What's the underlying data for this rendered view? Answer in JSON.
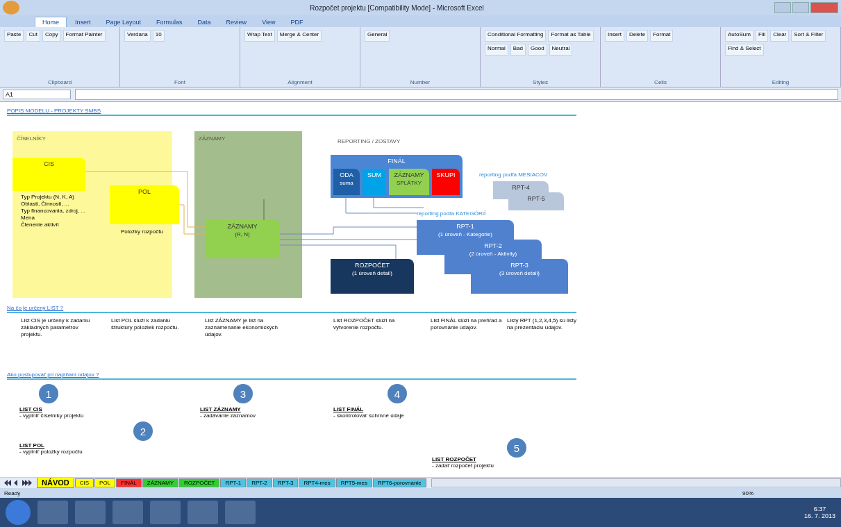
{
  "window": {
    "title": "Rozpočet projektu [Compatibility Mode] - Microsoft Excel"
  },
  "ribbon_tabs": [
    {
      "label": "Home",
      "selected": true
    },
    {
      "label": "Insert",
      "selected": false
    },
    {
      "label": "Page Layout",
      "selected": false
    },
    {
      "label": "Formulas",
      "selected": false
    },
    {
      "label": "Data",
      "selected": false
    },
    {
      "label": "Review",
      "selected": false
    },
    {
      "label": "View",
      "selected": false
    },
    {
      "label": "PDF",
      "selected": false
    }
  ],
  "ribbon_groups": [
    {
      "name": "Clipboard",
      "controls": [
        "Paste",
        "Cut",
        "Copy",
        "Format Painter"
      ]
    },
    {
      "name": "Font",
      "controls": [
        "Verdana",
        "10"
      ]
    },
    {
      "name": "Alignment",
      "controls": [
        "Wrap Text",
        "Merge & Center"
      ]
    },
    {
      "name": "Number",
      "controls": [
        "General"
      ]
    },
    {
      "name": "Styles",
      "controls": [
        "Conditional Formatting",
        "Format as Table",
        "Normal",
        "Bad",
        "Good",
        "Neutral"
      ]
    },
    {
      "name": "Cells",
      "controls": [
        "Insert",
        "Delete",
        "Format"
      ]
    },
    {
      "name": "Editing",
      "controls": [
        "AutoSum",
        "Fill",
        "Clear",
        "Sort & Filter",
        "Find & Select"
      ]
    }
  ],
  "name_box": "A1",
  "sheet": {
    "title": "POPIS MODELU - PROJEKTY SMBS",
    "panels": [
      {
        "label": "ČÍSELNÍKY",
        "kind": "codebook"
      },
      {
        "label": "ZÁZNAMY",
        "kind": "records"
      },
      {
        "label": "REPORTING / ZOSTAVY",
        "kind": "header"
      }
    ],
    "boxes": [
      {
        "label": "CIS",
        "color": "#ffff00"
      },
      {
        "label": "POL",
        "color": "#ffff00"
      },
      {
        "label": "ZÁZNAMY",
        "sub": "(R, N)",
        "color": "#92d050"
      },
      {
        "label": "FINÁL",
        "color": "#4a86d4"
      },
      {
        "label": "ODA",
        "sub": "suma",
        "color": "#1f5fa8"
      },
      {
        "label": "SUM",
        "color": "#00a2e8"
      },
      {
        "label": "ZÁZNAMY",
        "sub": "SPLÁTKY",
        "color": "#92d050"
      },
      {
        "label": "SKUPI",
        "color": "#ff0000"
      },
      {
        "label": "ROZPOČET",
        "sub": "(1 úroveň detail)",
        "color": "#17375e"
      },
      {
        "label": "RPT-4",
        "color": "#b9c7dc"
      },
      {
        "label": "RPT-5",
        "color": "#b9c7dc"
      },
      {
        "label": "RPT-1",
        "sub": "(1 úroveň - Kategórie)",
        "color": "#4f81cf"
      },
      {
        "label": "RPT-2",
        "sub": "(2 úroveň - Aktivity)",
        "color": "#4f81cf"
      },
      {
        "label": "RPT-3",
        "sub": "(3 úroveň detail)",
        "color": "#4f81cf"
      }
    ],
    "cis_items": [
      "Typ Projektu (N, K, A)",
      "Oblasti, Činnosti, ...",
      "Typ financovania, zdroj, ...",
      "Mena",
      "Členenie aktivít"
    ],
    "pol_items": [
      "Položky rozpočtu"
    ],
    "captions": [
      "reporting podľa MESIACOV",
      "reporting podľa KATEGÓRIÍ"
    ],
    "sections": [
      "Na čo je určený LIST ?",
      "Ako postupovať pri napĺňaní údajov ?"
    ],
    "purposes": [
      "List CIS je určený k zadaniu základných parametrov projektu.",
      "List POL slúži k zadaniu štruktúry položiek rozpočtu.",
      "List ZÁZNAMY je list na zaznamenanie ekonomických údajov.",
      "List ROZPOČET slúži na vytvorenie rozpočtu.",
      "List FINÁL slúži na prehľad a porovnanie údajov.",
      "Listy RPT (1,2,3,4,5) sú listy na prezentáciu údajov."
    ],
    "steps": [
      {
        "number": "1",
        "heading": "LIST CIS",
        "text": "- vyplniť číselníky projektu"
      },
      {
        "number": "2",
        "heading": "LIST POL",
        "text": "- vyplniť položky rozpočtu"
      },
      {
        "number": "3",
        "heading": "LIST ZÁZNAMY",
        "text": "- zadávanie záznamov"
      },
      {
        "number": "4",
        "heading": "LIST FINÁL",
        "text": "- skontrolovať súhrnné údaje"
      },
      {
        "number": "5",
        "heading": "LIST ROZPOČET",
        "text": "- zadať rozpočet projektu"
      }
    ]
  },
  "sheet_tabs": [
    {
      "label": "NÁVOD",
      "color": "#ffff00",
      "selected": true
    },
    {
      "label": "CIS",
      "color": "#ffff00",
      "selected": false
    },
    {
      "label": "POL",
      "color": "#ffff00",
      "selected": false
    },
    {
      "label": "FINÁL",
      "color": "#ff3030",
      "selected": false
    },
    {
      "label": "ZÁZNAMY",
      "color": "#33cc33",
      "selected": false
    },
    {
      "label": "ROZPOČET",
      "color": "#33cc33",
      "selected": false
    },
    {
      "label": "RPT-1",
      "color": "#4fc3e0",
      "selected": false
    },
    {
      "label": "RPT-2",
      "color": "#4fc3e0",
      "selected": false
    },
    {
      "label": "RPT-3",
      "color": "#4fc3e0",
      "selected": false
    },
    {
      "label": "RPT4-mes",
      "color": "#4fc3e0",
      "selected": false
    },
    {
      "label": "RPT5-mes",
      "color": "#4fc3e0",
      "selected": false
    },
    {
      "label": "RPT6-porovnanie",
      "color": "#4fc3e0",
      "selected": false
    }
  ],
  "status_bar": {
    "text": "Ready",
    "zoom": "90%"
  },
  "taskbar": {
    "time": "6:37",
    "date": "16. 7. 2013"
  }
}
